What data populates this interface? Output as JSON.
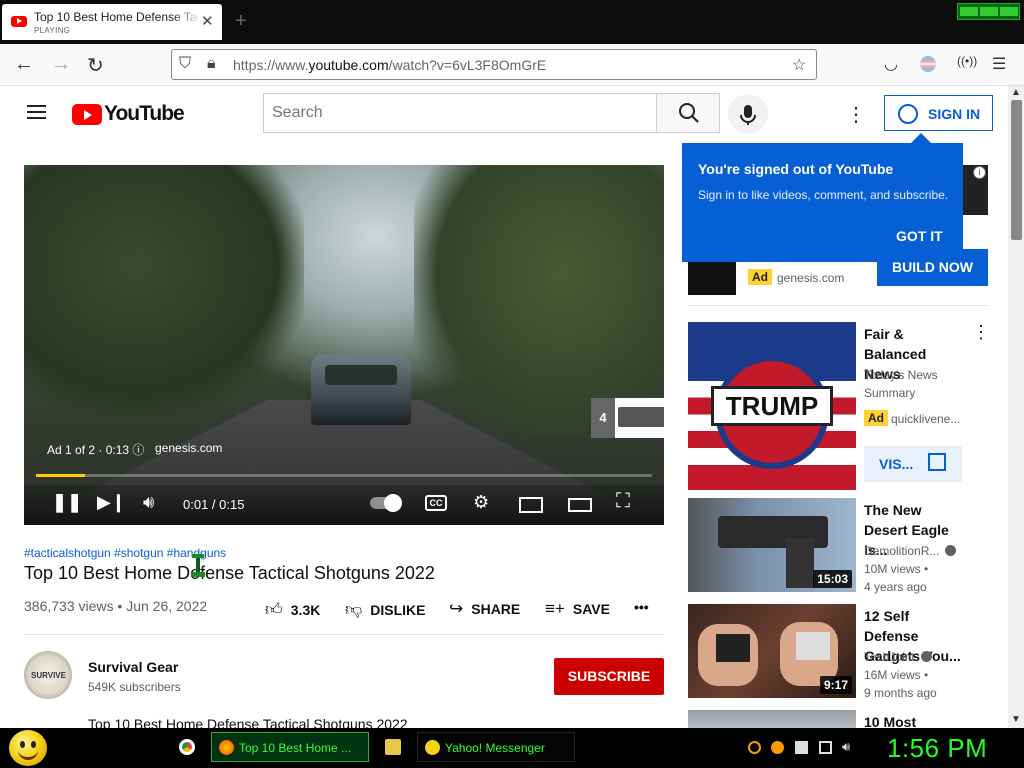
{
  "browser": {
    "tab": {
      "title": "Top 10 Best Home Defense Tactical Shotguns 2022",
      "status": "PLAYING"
    },
    "url_prefix": "https://www.",
    "url_domain": "youtube.com",
    "url_path": "/watch?v=6vL3F8OmGrE",
    "accent": "#065fd4"
  },
  "header": {
    "logo": "YouTube",
    "search_placeholder": "Search",
    "sign_in": "SIGN IN"
  },
  "player": {
    "ad_info": "Ad 1 of 2 · 0:13 ⓘ",
    "ad_domain": "genesis.com",
    "ad_queue_count": "4",
    "time": "0:01 / 0:15",
    "progress": 0.08,
    "cc": "CC"
  },
  "video": {
    "hashtags": "#tacticalshotgun #shotgun #handguns",
    "title": "Top 10 Best Home Defense Tactical Shotguns 2022",
    "views": "386,733 views",
    "date": "Jun 26, 2022",
    "meta_sep": " • ",
    "likes": "3.3K",
    "dislike": "DISLIKE",
    "share": "SHARE",
    "save": "SAVE"
  },
  "channel": {
    "name": "Survival Gear",
    "subscribers": "549K subscribers",
    "subscribe": "SUBSCRIBE",
    "avatar_text": "SURVIVE",
    "description_title": "Top 10 Best Home Defense Tactical Shotguns 2022"
  },
  "signed_out_popup": {
    "title": "You're signed out of YouTube",
    "body": "Sign in to like videos, comment, and subscribe.",
    "button": "GOT IT"
  },
  "promo_ad": {
    "badge": "Ad",
    "domain": "genesis.com",
    "button": "BUILD NOW"
  },
  "recommendations": [
    {
      "title": "Fair & Balanced News",
      "line1": "Today's News",
      "line2": "Summary",
      "ad_badge": "Ad",
      "channel": "quicklivene...",
      "button": "VIS...",
      "duration": ""
    },
    {
      "title": "The New Desert Eagle Is...",
      "channel": "DemolitionR...",
      "views": "10M views",
      "sep": " • ",
      "age": "4 years ago",
      "duration": "15:03"
    },
    {
      "title": "12 Self Defense Gadgets You...",
      "channel": "TechJoint",
      "views": "16M views",
      "sep": " • ",
      "age": "9 months ago",
      "duration": "9:17"
    },
    {
      "title": "10 Most",
      "duration": ""
    }
  ],
  "thumb_text": {
    "trump": "TRUMP"
  },
  "taskbar": {
    "tasks": [
      {
        "label": "Top 10 Best Home ...",
        "active": true
      },
      {
        "label": "Yahoo! Messenger",
        "active": false
      }
    ],
    "clock": "1:56 PM"
  }
}
